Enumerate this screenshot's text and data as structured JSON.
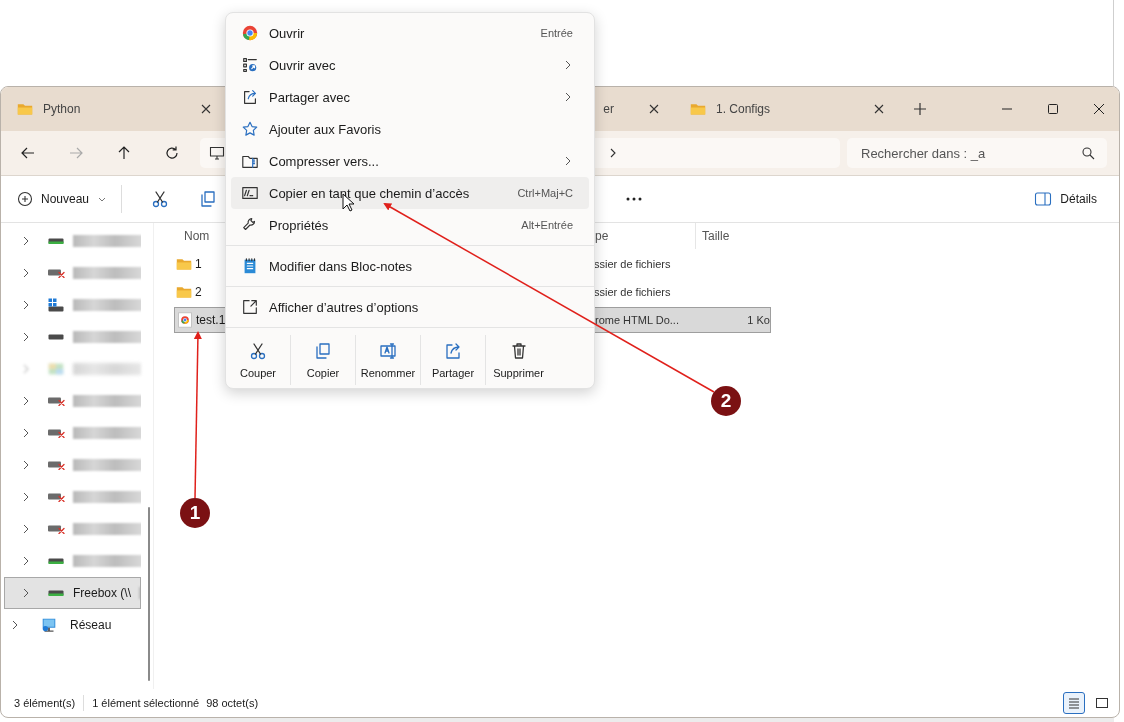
{
  "tabs": [
    {
      "label": "Python",
      "has_icon": true
    },
    {
      "label": "er",
      "has_icon": false
    },
    {
      "label": "1. Configs",
      "has_icon": true
    }
  ],
  "navigation": {
    "forward_disabled": true
  },
  "search": {
    "placeholder": "Rechercher dans : _a"
  },
  "command_bar": {
    "new_label": "Nouveau",
    "details_label": "Détails"
  },
  "sidebar": {
    "tree": [
      {
        "children": [
          {
            "kind": "drive",
            "redacted": true,
            "selected": false
          },
          {
            "kind": "drive-offline",
            "redacted": true,
            "selected": false
          },
          {
            "kind": "system-drive",
            "redacted": true,
            "selected": false
          },
          {
            "kind": "drive-plain",
            "redacted": true,
            "selected": false
          },
          {
            "kind": "blurred",
            "redacted": true,
            "selected": false
          },
          {
            "kind": "drive-offline",
            "redacted": true,
            "selected": false
          },
          {
            "kind": "drive-offline",
            "redacted": true,
            "selected": false
          },
          {
            "kind": "drive-offline",
            "redacted": true,
            "selected": false
          },
          {
            "kind": "drive-offline",
            "redacted": true,
            "selected": false
          },
          {
            "kind": "drive-offline",
            "redacted": true,
            "selected": false
          },
          {
            "kind": "drive",
            "redacted": true,
            "selected": false
          },
          {
            "kind": "drive",
            "label": "Freebox (\\\\",
            "redacted": true,
            "selected": true
          }
        ]
      },
      {
        "kind": "network",
        "label": "Réseau",
        "selected": false
      }
    ]
  },
  "file_list": {
    "columns": [
      "Nom",
      "pe",
      "Taille"
    ],
    "rows": [
      {
        "kind": "folder",
        "name": "1",
        "type": "ssier de fichiers",
        "selected": false
      },
      {
        "kind": "folder",
        "name": "2",
        "type": "ssier de fichiers",
        "selected": false
      },
      {
        "kind": "file",
        "name": "test.1",
        "type": "rome HTML Do...",
        "size": "1 Ko",
        "selected": true
      }
    ]
  },
  "status_bar": {
    "item_count": "3 élément(s)",
    "selection": "1 élément sélectionné",
    "selection_size": "98 octet(s)",
    "view_buttons": [
      {
        "selected": true
      },
      {
        "selected": false
      }
    ]
  },
  "context_menu": {
    "sections": [
      [
        {
          "label": "Ouvrir",
          "shortcut": "Entrée",
          "submenu": false,
          "highlighted": false
        },
        {
          "label": "Ouvrir avec",
          "submenu": true,
          "highlighted": false
        },
        {
          "label": "Partager avec",
          "submenu": true,
          "highlighted": false
        },
        {
          "label": "Ajouter aux Favoris",
          "submenu": false,
          "highlighted": false
        },
        {
          "label": "Compresser vers...",
          "submenu": true,
          "highlighted": false
        },
        {
          "label": "Copier en tant que chemin d’accès",
          "shortcut": "Ctrl+Maj+C",
          "submenu": false,
          "highlighted": true
        },
        {
          "label": "Propriétés",
          "shortcut": "Alt+Entrée",
          "submenu": false,
          "highlighted": false
        }
      ],
      [
        {
          "label": "Modifier dans Bloc-notes",
          "submenu": false,
          "highlighted": false
        }
      ],
      [
        {
          "label": "Afficher d’autres d’options",
          "submenu": false,
          "highlighted": false
        }
      ]
    ],
    "actions": [
      "Couper",
      "Copier",
      "Renommer",
      "Partager",
      "Supprimer"
    ]
  },
  "annotations": [
    {
      "number": "1"
    },
    {
      "number": "2"
    }
  ]
}
